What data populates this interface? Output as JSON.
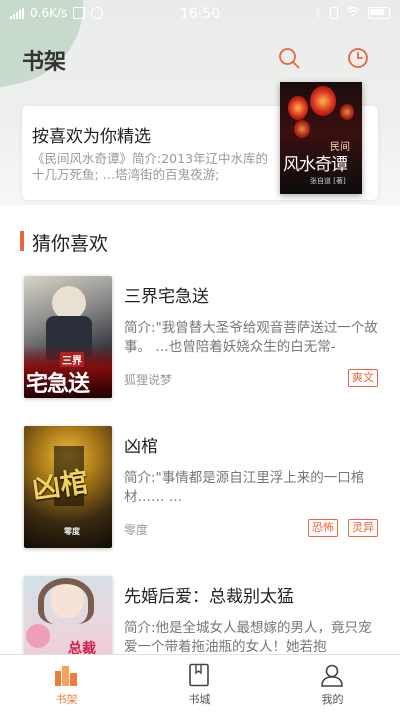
{
  "status_bar": {
    "network": "0.6K/s",
    "time": "16:50"
  },
  "header": {
    "title": "书架",
    "search_icon": "search-icon",
    "history_icon": "clock-icon",
    "accent": "#e8663d"
  },
  "recommend": {
    "title": "按喜欢为你精选",
    "desc": "《民间风水奇谭》简介:2013年辽中水库的十几万死鱼; …塔湾街的百鬼夜游;",
    "cover_text": {
      "top": "民间",
      "main": "风水奇谭",
      "author": "张自道 [著]"
    }
  },
  "section": {
    "title": "猜你喜欢"
  },
  "books": [
    {
      "title": "三界宅急送",
      "desc": "简介:\"我曾替大圣爷给观音菩萨送过一个故事。 …也曾陪着妖娆众生的白无常-",
      "author": "狐狸说梦",
      "tags": [
        "爽文"
      ],
      "cover_text": {
        "small": "三界",
        "big": "宅急送"
      }
    },
    {
      "title": "凶棺",
      "desc": "简介:\"事情都是源自江里浮上来的一口棺材…… …",
      "author": "零度",
      "tags": [
        "恐怖",
        "灵异"
      ],
      "cover_text": {
        "big": "凶棺",
        "small": "零度"
      }
    },
    {
      "title": "先婚后爱：总裁别太猛",
      "desc": "简介:他是全城女人最想嫁的男人，竟只宠爱一个带着拖油瓶的女人！她若抱",
      "author": "",
      "tags": [],
      "cover_text": {
        "big": "总裁"
      }
    }
  ],
  "tabbar": [
    {
      "label": "书架",
      "icon": "bookshelf-icon",
      "active": true
    },
    {
      "label": "书城",
      "icon": "book-icon",
      "active": false
    },
    {
      "label": "我的",
      "icon": "user-icon",
      "active": false
    }
  ]
}
